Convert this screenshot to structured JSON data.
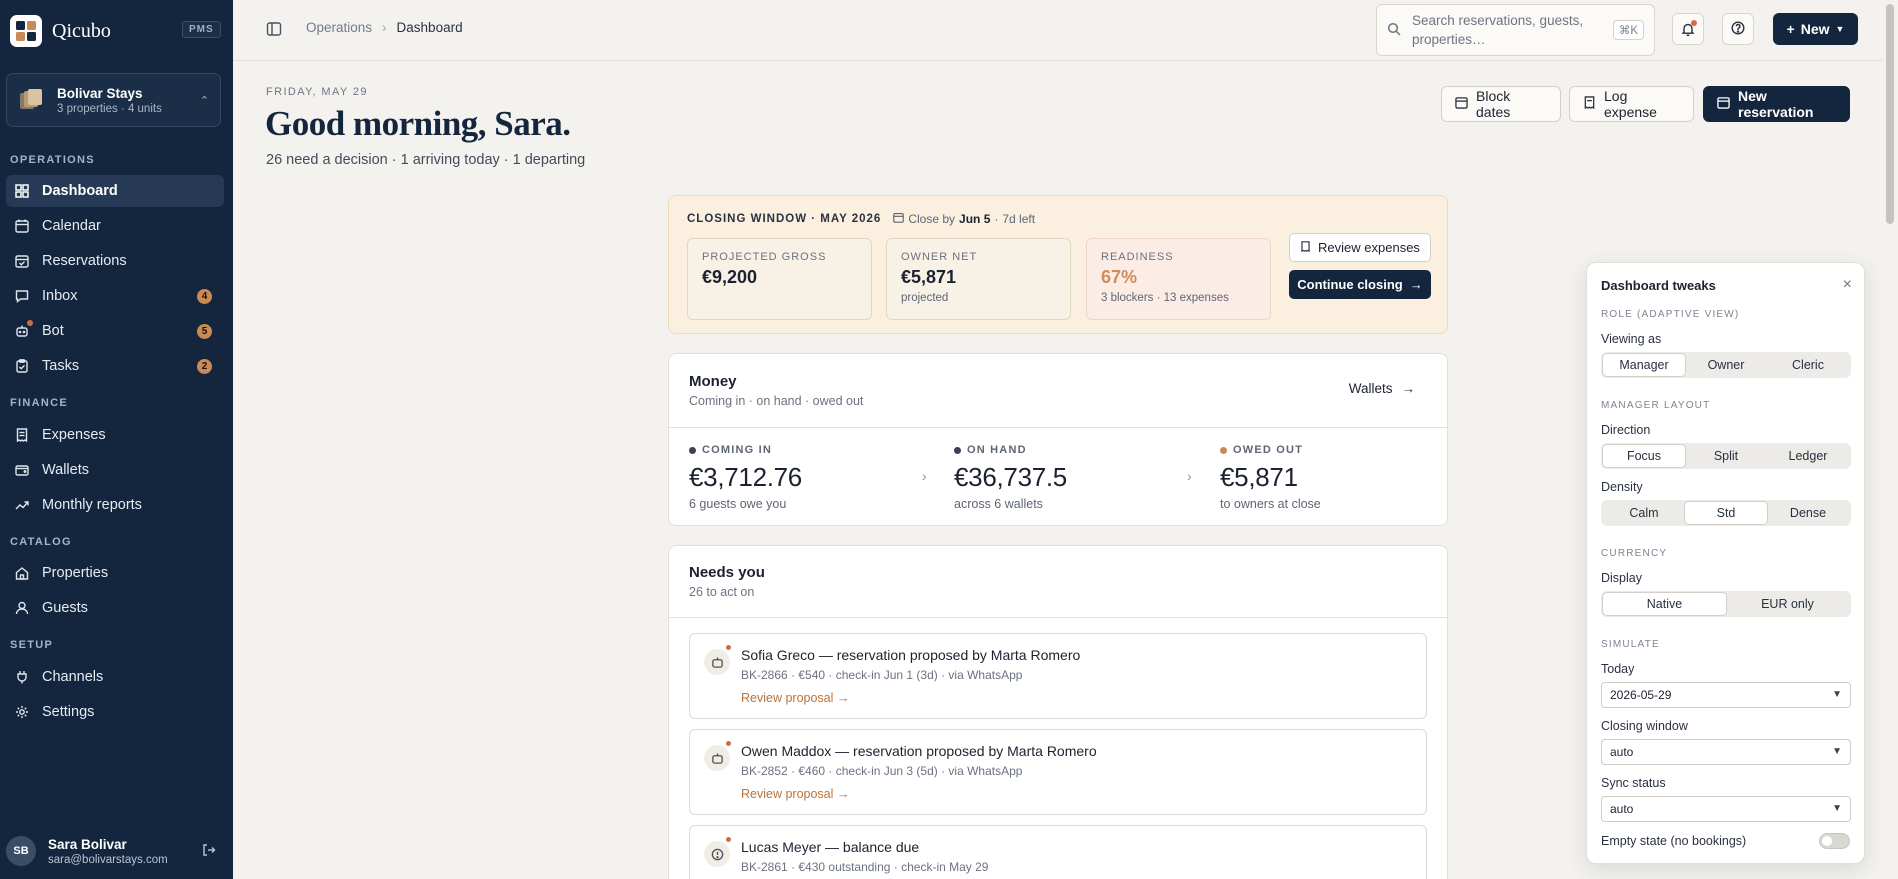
{
  "app": {
    "name": "Qicubo",
    "tag": "PMS"
  },
  "org": {
    "name": "Bolivar Stays",
    "sub": "3 properties · 4 units"
  },
  "nav": {
    "operations_label": "OPERATIONS",
    "dashboard": "Dashboard",
    "calendar": "Calendar",
    "reservations": "Reservations",
    "inbox": "Inbox",
    "inbox_badge": "4",
    "bot": "Bot",
    "bot_badge": "5",
    "tasks": "Tasks",
    "tasks_badge": "2",
    "finance_label": "FINANCE",
    "expenses": "Expenses",
    "wallets": "Wallets",
    "monthly_reports": "Monthly reports",
    "catalog_label": "CATALOG",
    "properties": "Properties",
    "guests": "Guests",
    "setup_label": "SETUP",
    "channels": "Channels",
    "settings": "Settings"
  },
  "user": {
    "initials": "SB",
    "name": "Sara Bolivar",
    "email": "sara@bolivarstays.com"
  },
  "topbar": {
    "crumb_parent": "Operations",
    "crumb_current": "Dashboard",
    "search_placeholder": "Search reservations, guests, properties…",
    "shortcut": "⌘K",
    "new_label": "New"
  },
  "header": {
    "date": "FRIDAY, MAY 29",
    "greeting": "Good morning, Sara.",
    "summary": "26 need a decision · 1 arriving today · 1 departing",
    "block_dates": "Block dates",
    "log_expense": "Log expense",
    "new_reservation": "New reservation"
  },
  "closing": {
    "title": "CLOSING WINDOW · MAY 2026",
    "close_by_prefix": "Close by",
    "close_by_date": "Jun 5",
    "time_left": "7d left",
    "gross_label": "PROJECTED GROSS",
    "gross_value": "€9,200",
    "net_label": "OWNER NET",
    "net_value": "€5,871",
    "net_note": "projected",
    "ready_label": "READINESS",
    "ready_value": "67%",
    "ready_note": "3 blockers · 13 expenses",
    "review_btn": "Review expenses",
    "continue_btn": "Continue closing"
  },
  "money": {
    "title": "Money",
    "subtitle": "Coming in · on hand · owed out",
    "wallets_link": "Wallets",
    "coming_label": "COMING IN",
    "coming_value": "€3,712.76",
    "coming_note": "6 guests owe you",
    "hand_label": "ON HAND",
    "hand_value": "€36,737.5",
    "hand_note": "across 6 wallets",
    "owed_label": "OWED OUT",
    "owed_value": "€5,871",
    "owed_note": "to owners at close"
  },
  "needs": {
    "title": "Needs you",
    "subtitle": "26 to act on",
    "items": [
      {
        "title": "Sofia Greco — reservation proposed by Marta Romero",
        "meta": "BK-2866 · €540 · check-in Jun 1 (3d) · via WhatsApp",
        "link": "Review proposal →"
      },
      {
        "title": "Owen Maddox — reservation proposed by Marta Romero",
        "meta": "BK-2852 · €460 · check-in Jun 3 (5d) · via WhatsApp",
        "link": "Review proposal →"
      },
      {
        "title": "Lucas Meyer — balance due",
        "meta": "BK-2861 · €430 outstanding · check-in May 29",
        "link": ""
      }
    ]
  },
  "tweaks": {
    "title": "Dashboard tweaks",
    "role_section": "ROLE (ADAPTIVE VIEW)",
    "viewing_as": "Viewing as",
    "roles": [
      "Manager",
      "Owner",
      "Cleric"
    ],
    "layout_section": "MANAGER LAYOUT",
    "direction": "Direction",
    "directions": [
      "Focus",
      "Split",
      "Ledger"
    ],
    "density": "Density",
    "densities": [
      "Calm",
      "Std",
      "Dense"
    ],
    "currency_section": "CURRENCY",
    "display": "Display",
    "displays": [
      "Native",
      "EUR only"
    ],
    "simulate_section": "SIMULATE",
    "today": "Today",
    "today_value": "2026-05-29",
    "closing_window": "Closing window",
    "closing_value": "auto",
    "sync_status": "Sync status",
    "sync_value": "auto",
    "empty_state": "Empty state (no bookings)",
    "empty_state_on": false
  },
  "colors": {
    "navy": "#14263d",
    "accent": "#c98a55",
    "link": "#c0703e",
    "readiness": "#d28c58"
  }
}
